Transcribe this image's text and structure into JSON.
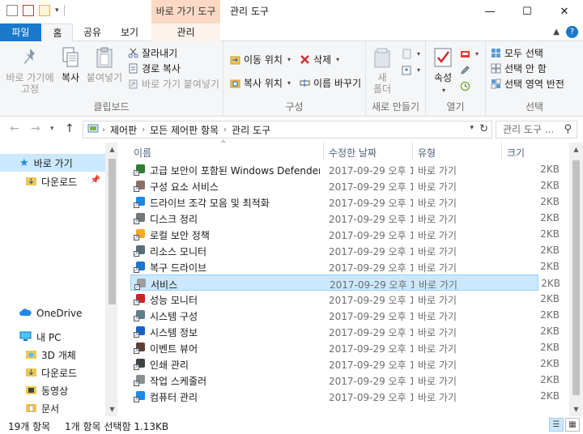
{
  "window": {
    "contextual_tab": "바로 가기 도구",
    "title": "관리 도구",
    "minimize": "—",
    "maximize": "☐",
    "close": "✕"
  },
  "tabs": {
    "file": "파일",
    "home": "홈",
    "share": "공유",
    "view": "보기",
    "manage": "관리"
  },
  "ribbon": {
    "clipboard": {
      "label": "클립보드",
      "pin": "바로 가기에\n고정",
      "copy": "복사",
      "paste": "붙여넣기",
      "cut": "잘라내기",
      "copy_path": "경로 복사",
      "paste_shortcut": "바로 가기 붙여넣기"
    },
    "organize": {
      "label": "구성",
      "move_to": "이동 위치",
      "copy_to": "복사 위치",
      "delete": "삭제",
      "rename": "이름 바꾸기"
    },
    "new": {
      "label": "새로 만들기",
      "new_folder": "새\n폴더"
    },
    "open": {
      "label": "열기",
      "properties": "속성"
    },
    "select": {
      "label": "선택",
      "select_all": "모두 선택",
      "select_none": "선택 안 함",
      "invert": "선택 영역 반전"
    }
  },
  "address": {
    "crumbs": [
      "제어판",
      "모든 제어판 항목",
      "관리 도구"
    ],
    "search_placeholder": "관리 도구 ..."
  },
  "nav": {
    "quick_access": "바로 가기",
    "downloads": "다운로드",
    "onedrive": "OneDrive",
    "this_pc": "내 PC",
    "objects3d": "3D 개체",
    "downloads2": "다운로드",
    "videos": "동영상",
    "documents": "문서"
  },
  "columns": {
    "name": "이름",
    "date": "수정한 날짜",
    "type": "유형",
    "size": "크기"
  },
  "files": [
    {
      "name": "고급 보안이 포함된 Windows Defender ...",
      "date": "2017-09-29 오후 1...",
      "type": "바로 가기",
      "size": "2KB",
      "color": "#2e7d32"
    },
    {
      "name": "구성 요소 서비스",
      "date": "2017-09-29 오후 1...",
      "type": "바로 가기",
      "size": "2KB",
      "color": "#8d6e63"
    },
    {
      "name": "드라이브 조각 모음 및 최적화",
      "date": "2017-09-29 오후 1...",
      "type": "바로 가기",
      "size": "2KB",
      "color": "#1e88e5"
    },
    {
      "name": "디스크 정리",
      "date": "2017-09-29 오후 1...",
      "type": "바로 가기",
      "size": "2KB",
      "color": "#757575"
    },
    {
      "name": "로컬 보안 정책",
      "date": "2017-09-29 오후 1...",
      "type": "바로 가기",
      "size": "2KB",
      "color": "#f9a825"
    },
    {
      "name": "리소스 모니터",
      "date": "2017-09-29 오후 1...",
      "type": "바로 가기",
      "size": "2KB",
      "color": "#546e7a"
    },
    {
      "name": "복구 드라이브",
      "date": "2017-09-29 오후 1...",
      "type": "바로 가기",
      "size": "2KB",
      "color": "#1976d2"
    },
    {
      "name": "서비스",
      "date": "2017-09-29 오후 1...",
      "type": "바로 가기",
      "size": "2KB",
      "color": "#9e9e9e"
    },
    {
      "name": "성능 모니터",
      "date": "2017-09-29 오후 1...",
      "type": "바로 가기",
      "size": "2KB",
      "color": "#c62828"
    },
    {
      "name": "시스템 구성",
      "date": "2017-09-29 오후 1...",
      "type": "바로 가기",
      "size": "2KB",
      "color": "#607d8b"
    },
    {
      "name": "시스템 정보",
      "date": "2017-09-29 오후 1...",
      "type": "바로 가기",
      "size": "2KB",
      "color": "#1565c0"
    },
    {
      "name": "이벤트 뷰어",
      "date": "2017-09-29 오후 1...",
      "type": "바로 가기",
      "size": "2KB",
      "color": "#5d4037"
    },
    {
      "name": "인쇄 관리",
      "date": "2017-09-29 오후 1...",
      "type": "바로 가기",
      "size": "2KB",
      "color": "#424242"
    },
    {
      "name": "작업 스케줄러",
      "date": "2017-09-29 오후 1...",
      "type": "바로 가기",
      "size": "2KB",
      "color": "#8e8e8e"
    },
    {
      "name": "컴퓨터 관리",
      "date": "2017-09-29 오후 1...",
      "type": "바로 가기",
      "size": "2KB",
      "color": "#1e88e5"
    }
  ],
  "selected_index": 7,
  "status": {
    "count": "19개 항목",
    "selection": "1개 항목 선택함 1.13KB"
  },
  "colors": {
    "accent": "#1979ca",
    "selection_bg": "#cce8ff",
    "contextual": "#fbd9c5"
  }
}
